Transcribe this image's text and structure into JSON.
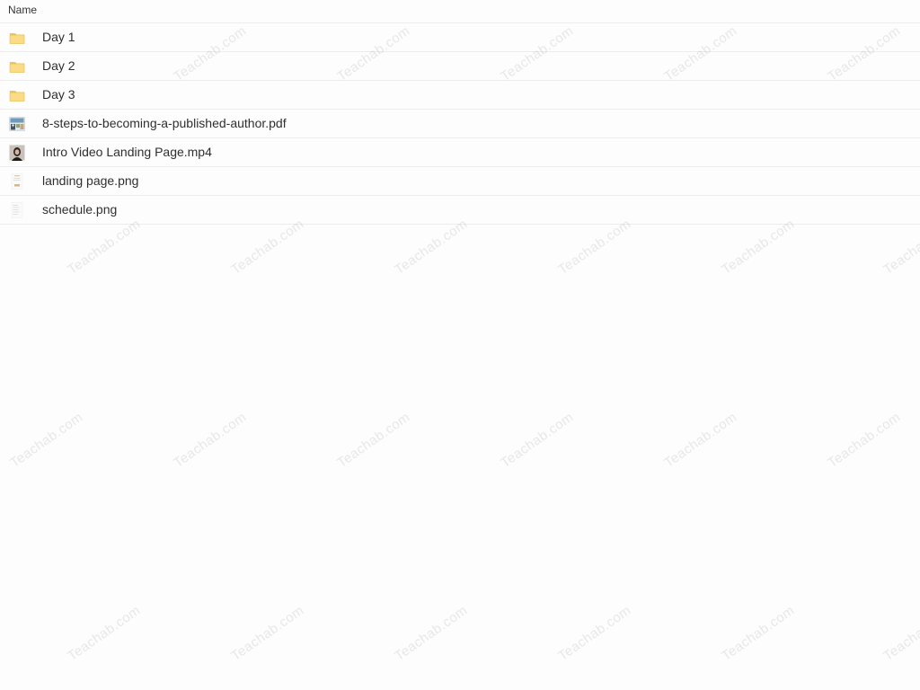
{
  "header": {
    "column_name": "Name"
  },
  "files": [
    {
      "name": "Day 1",
      "icon": "folder-icon"
    },
    {
      "name": "Day 2",
      "icon": "folder-icon"
    },
    {
      "name": "Day 3",
      "icon": "folder-icon"
    },
    {
      "name": "8-steps-to-becoming-a-published-author.pdf",
      "icon": "pdf-thumbnail-icon"
    },
    {
      "name": "Intro Video Landing Page.mp4",
      "icon": "video-thumbnail-icon"
    },
    {
      "name": "landing page.png",
      "icon": "image-thumbnail-icon"
    },
    {
      "name": "schedule.png",
      "icon": "image-thumbnail-icon"
    }
  ],
  "watermark": {
    "text": "Teachab.com"
  },
  "colors": {
    "folder": "#f7d774",
    "folder_tab": "#efc555",
    "divider": "#ececec",
    "watermark": "#787878"
  }
}
